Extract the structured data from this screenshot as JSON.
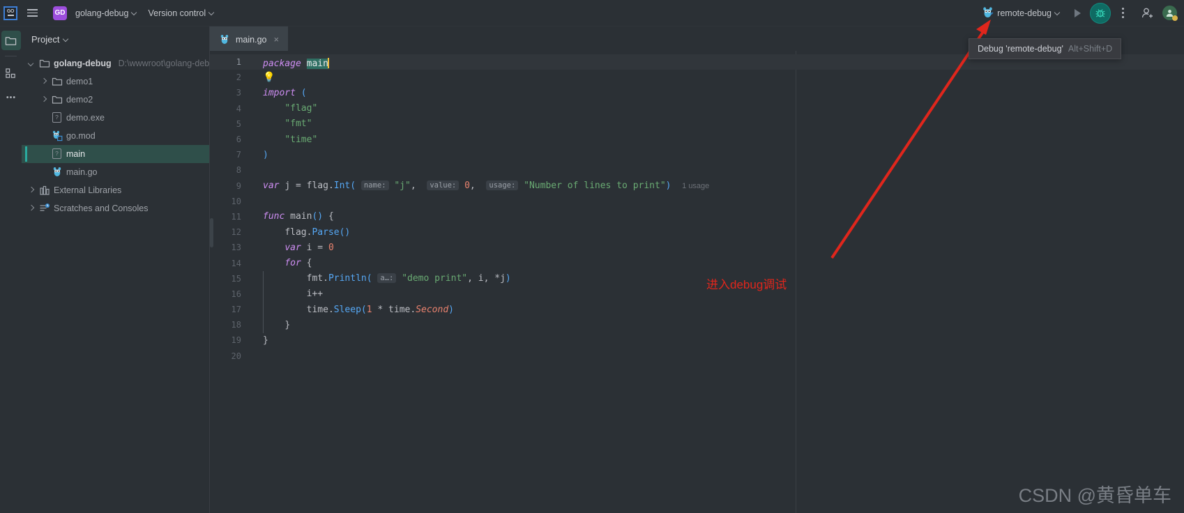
{
  "toolbar": {
    "logo_text": "GO",
    "menu_icon": "hamburger-icon",
    "project_badge": "GD",
    "project_name": "golang-debug",
    "version_control": "Version control",
    "run_config": "remote-debug",
    "run_icon": "run-triangle-icon",
    "debug_icon": "debug-bug-icon",
    "more_icon": "kebab-more-icon",
    "account_icon": "add-account-icon",
    "avatar_icon": "user-avatar-icon"
  },
  "tooltip": {
    "text": "Debug 'remote-debug'",
    "shortcut": "Alt+Shift+D"
  },
  "rail": {
    "items": [
      {
        "name": "project-icon",
        "active": true
      },
      {
        "name": "structure-icon",
        "active": false
      },
      {
        "name": "more-tool-windows-icon",
        "active": false
      }
    ]
  },
  "project_panel": {
    "title": "Project",
    "tree": [
      {
        "indent": 0,
        "twisty": "open",
        "icon": "folder-icon",
        "label": "golang-debug",
        "path": "D:\\wwwroot\\golang-debug",
        "root": true,
        "selected": false
      },
      {
        "indent": 1,
        "twisty": "closed",
        "icon": "folder-icon",
        "label": "demo1",
        "path": "",
        "root": false,
        "selected": false
      },
      {
        "indent": 1,
        "twisty": "closed",
        "icon": "folder-icon",
        "label": "demo2",
        "path": "",
        "root": false,
        "selected": false
      },
      {
        "indent": 1,
        "twisty": "none",
        "icon": "unknown-file-icon",
        "label": "demo.exe",
        "path": "",
        "root": false,
        "selected": false
      },
      {
        "indent": 1,
        "twisty": "none",
        "icon": "go-mod-icon",
        "label": "go.mod",
        "path": "",
        "root": false,
        "selected": false
      },
      {
        "indent": 1,
        "twisty": "none",
        "icon": "unknown-file-icon",
        "label": "main",
        "path": "",
        "root": false,
        "selected": true
      },
      {
        "indent": 1,
        "twisty": "none",
        "icon": "go-file-icon",
        "label": "main.go",
        "path": "",
        "root": false,
        "selected": false
      },
      {
        "indent": 0,
        "twisty": "closed",
        "icon": "library-icon",
        "label": "External Libraries",
        "path": "",
        "root": false,
        "selected": false
      },
      {
        "indent": 0,
        "twisty": "closed",
        "icon": "scratches-icon",
        "label": "Scratches and Consoles",
        "path": "",
        "root": false,
        "selected": false
      }
    ]
  },
  "editor": {
    "tabs": [
      {
        "label": "main.go",
        "icon": "go-file-icon",
        "close_label": "×",
        "active": true
      }
    ],
    "lines": [
      {
        "n": "1",
        "current": true,
        "mark": "",
        "html": "<span class=\"kw\">package</span> <span class=\"sel-main\">main</span><span class=\"caret\"></span>"
      },
      {
        "n": "2",
        "current": false,
        "mark": "bulb",
        "html": ""
      },
      {
        "n": "3",
        "current": false,
        "mark": "",
        "html": "<span class=\"kw\">import</span> <span class=\"paren\">(</span>"
      },
      {
        "n": "4",
        "current": false,
        "mark": "",
        "html": "    <span class=\"str\">\"flag\"</span>"
      },
      {
        "n": "5",
        "current": false,
        "mark": "",
        "html": "    <span class=\"str\">\"fmt\"</span>"
      },
      {
        "n": "6",
        "current": false,
        "mark": "",
        "html": "    <span class=\"str\">\"time\"</span>"
      },
      {
        "n": "7",
        "current": false,
        "mark": "",
        "html": "<span class=\"paren\">)</span>"
      },
      {
        "n": "8",
        "current": false,
        "mark": "",
        "html": ""
      },
      {
        "n": "9",
        "current": false,
        "mark": "",
        "html": "<span class=\"kw\">var</span> <span class=\"ident\">j</span> <span class=\"punct\">=</span> <span class=\"ident\">flag</span><span class=\"punct\">.</span><span class=\"fn\">Int</span><span class=\"paren\">(</span> <span class=\"hintchip\">name:</span> <span class=\"str\">\"j\"</span><span class=\"punct\">,</span>  <span class=\"hintchip\">value:</span> <span class=\"num\">0</span><span class=\"punct\">,</span>  <span class=\"hintchip\">usage:</span> <span class=\"str\">\"Number of lines to print\"</span><span class=\"paren\">)</span>  <span class=\"usage\">1 usage</span>"
      },
      {
        "n": "10",
        "current": false,
        "mark": "",
        "html": ""
      },
      {
        "n": "11",
        "current": false,
        "mark": "run",
        "html": "<span class=\"kw\">func</span> <span class=\"ident\">main</span><span class=\"paren\">()</span> <span class=\"punct\">{</span>"
      },
      {
        "n": "12",
        "current": false,
        "mark": "",
        "html": "    <span class=\"ident\">flag</span><span class=\"punct\">.</span><span class=\"fn\">Parse</span><span class=\"paren\">()</span>"
      },
      {
        "n": "13",
        "current": false,
        "mark": "",
        "html": "    <span class=\"kw\">var</span> <span class=\"ident\">i</span> <span class=\"punct\">=</span> <span class=\"num\">0</span>"
      },
      {
        "n": "14",
        "current": false,
        "mark": "",
        "html": "    <span class=\"kw\">for</span> <span class=\"punct\">{</span>"
      },
      {
        "n": "15",
        "current": false,
        "mark": "",
        "html": "        <span class=\"ident\">fmt</span><span class=\"punct\">.</span><span class=\"fn\">Println</span><span class=\"paren\">(</span> <span class=\"hintchip\">a…:</span> <span class=\"str\">\"demo print\"</span><span class=\"punct\">,</span> <span class=\"ident\">i</span><span class=\"punct\">,</span> <span class=\"punct\">*</span><span class=\"ident\">j</span><span class=\"paren\">)</span>"
      },
      {
        "n": "16",
        "current": false,
        "mark": "",
        "html": "        <span class=\"ident\">i</span><span class=\"punct\">++</span>"
      },
      {
        "n": "17",
        "current": false,
        "mark": "",
        "html": "        <span class=\"ident\">time</span><span class=\"punct\">.</span><span class=\"fn\">Sleep</span><span class=\"paren\">(</span><span class=\"num\">1</span> <span class=\"punct\">*</span> <span class=\"ident\">time</span><span class=\"punct\">.</span><span class=\"type-it\">Second</span><span class=\"paren\">)</span>"
      },
      {
        "n": "18",
        "current": false,
        "mark": "",
        "html": "    <span class=\"punct\">}</span>"
      },
      {
        "n": "19",
        "current": false,
        "mark": "",
        "html": "<span class=\"punct\">}</span>"
      },
      {
        "n": "20",
        "current": false,
        "mark": "",
        "html": ""
      }
    ]
  },
  "annotation": {
    "text": "进入debug调试",
    "color": "#e0261c"
  },
  "watermark": {
    "text": "CSDN @黄昏单车"
  },
  "colors": {
    "toolbar_bg": "#2b3035",
    "editor_bg": "#2b3035",
    "selection_green": "#2f6f63",
    "debug_green": "#0f6b63",
    "accent_purple": "#9d4edd",
    "annotation_red": "#e0261c"
  }
}
